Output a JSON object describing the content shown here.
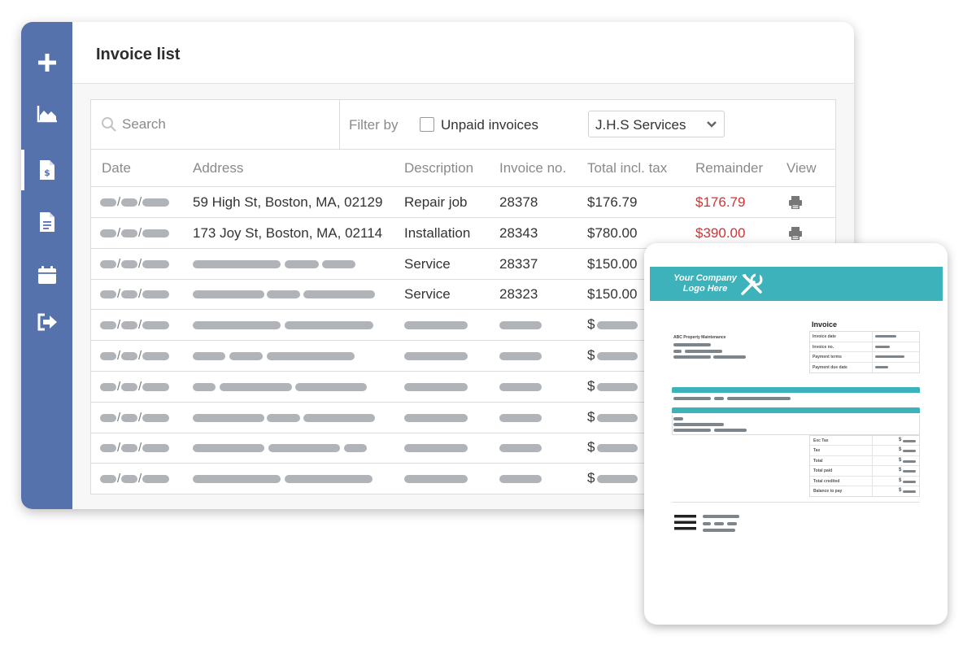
{
  "sidebar": {
    "items": [
      {
        "name": "add-icon",
        "active": false
      },
      {
        "name": "chart-icon",
        "active": false
      },
      {
        "name": "invoice-icon",
        "active": true
      },
      {
        "name": "document-icon",
        "active": false
      },
      {
        "name": "calendar-icon",
        "active": false
      },
      {
        "name": "logout-icon",
        "active": false
      }
    ]
  },
  "header": {
    "title": "Invoice list"
  },
  "toolbar": {
    "search_placeholder": "Search",
    "filter_label": "Filter by",
    "unpaid_label": "Unpaid invoices",
    "unpaid_checked": false,
    "client_select": "J.H.S Services"
  },
  "columns": {
    "date": "Date",
    "address": "Address",
    "description": "Description",
    "invoice_no": "Invoice no.",
    "total": "Total incl. tax",
    "remainder": "Remainder",
    "view": "View"
  },
  "rows": [
    {
      "address": "59 High St, Boston, MA, 02129",
      "description": "Repair job",
      "invoice_no": "28378",
      "total": "$176.79",
      "remainder": "$176.79"
    },
    {
      "address": "173 Joy St, Boston, MA, 02114",
      "description": "Installation",
      "invoice_no": "28343",
      "total": "$780.00",
      "remainder": "$390.00"
    },
    {
      "address": "",
      "description": "Service",
      "invoice_no": "28337",
      "total": "$150.00",
      "remainder": ""
    },
    {
      "address": "",
      "description": "Service",
      "invoice_no": "28323",
      "total": "$150.00",
      "remainder": ""
    }
  ],
  "placeholder_rows": {
    "date_separator": "/",
    "currency": "$"
  },
  "invoice_doc": {
    "logo_text": "Your Company Logo Here",
    "title": "Invoice",
    "company": "ABC Property Maintenance",
    "meta": [
      "Invoice date",
      "Invoice no.",
      "Payment terms",
      "Payment due date"
    ],
    "totals": [
      "Exc Tax",
      "Tax",
      "Total",
      "Total paid",
      "Total credited",
      "Balance to pay"
    ],
    "currency": "$",
    "accent": "#3db2bb"
  },
  "colors": {
    "sidebar": "#5672ad",
    "overdue": "#d63131"
  }
}
